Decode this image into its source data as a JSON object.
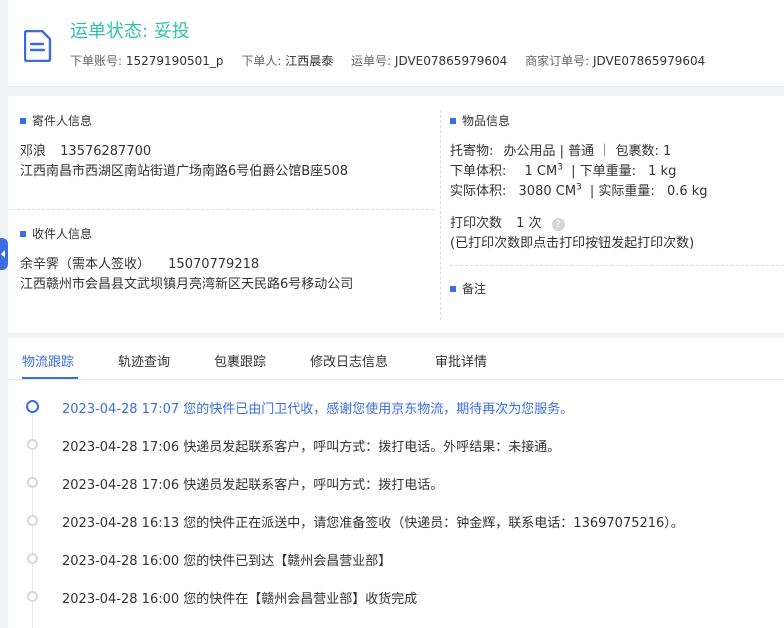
{
  "header": {
    "status_label": "运单状态:",
    "status_value": "妥投",
    "meta": [
      {
        "label": "下单账号:",
        "value": "15279190501_p"
      },
      {
        "label": "下单人:",
        "value": "江西晨泰"
      },
      {
        "label": "运单号:",
        "value": "JDVE07865979604"
      },
      {
        "label": "商家订单号:",
        "value": "JDVE07865979604"
      }
    ]
  },
  "sender": {
    "title": "寄件人信息",
    "name": "邓浪",
    "phone": "13576287700",
    "address": "江西南昌市西湖区南站街道广场南路6号伯爵公馆B座508"
  },
  "receiver": {
    "title": "收件人信息",
    "name": "余辛霁（需本人签收）",
    "phone": "15070779218",
    "address": "江西赣州市会昌县文武坝镇月亮湾新区天民路6号移动公司"
  },
  "goods": {
    "title": "物品信息",
    "line1_label": "托寄物:",
    "line1_value": "办公用品 | 普通 ｜ 包裹数:  1",
    "order_volume_label": "下单体积:",
    "order_volume_value": "1 CM",
    "order_weight_label": "| 下单重量:",
    "order_weight_value": "1 kg",
    "actual_volume_label": "实际体积:",
    "actual_volume_value": "3080 CM",
    "actual_weight_label": "| 实际重量:",
    "actual_weight_value": "0.6 kg",
    "cube_sup": "3",
    "print_label": "打印次数",
    "print_count": "1 次",
    "print_hint": "(已打印次数即点击打印按钮发起打印次数)"
  },
  "remark": {
    "title": "备注"
  },
  "tabs": [
    "物流跟踪",
    "轨迹查询",
    "包裹跟踪",
    "修改日志信息",
    "审批详情"
  ],
  "events": [
    {
      "time": "2023-04-28 17:07",
      "text": "您的快件已由门卫代收，感谢您使用京东物流，期待再次为您服务。"
    },
    {
      "time": "2023-04-28 17:06",
      "text": "快递员发起联系客户，呼叫方式：拨打电话。外呼结果：未接通。"
    },
    {
      "time": "2023-04-28 17:06",
      "text": "快递员发起联系客户，呼叫方式：拨打电话。"
    },
    {
      "time": "2023-04-28 16:13",
      "text": "您的快件正在派送中，请您准备签收（快递员：钟金辉，联系电话：13697075216）。"
    },
    {
      "time": "2023-04-28 16:00",
      "text": "您的快件已到达【赣州会昌营业部】"
    },
    {
      "time": "2023-04-28 16:00",
      "text": "您的快件在【赣州会昌营业部】收货完成"
    }
  ],
  "colors": {
    "accent": "#3b6de0",
    "status": "#31c3a8"
  }
}
